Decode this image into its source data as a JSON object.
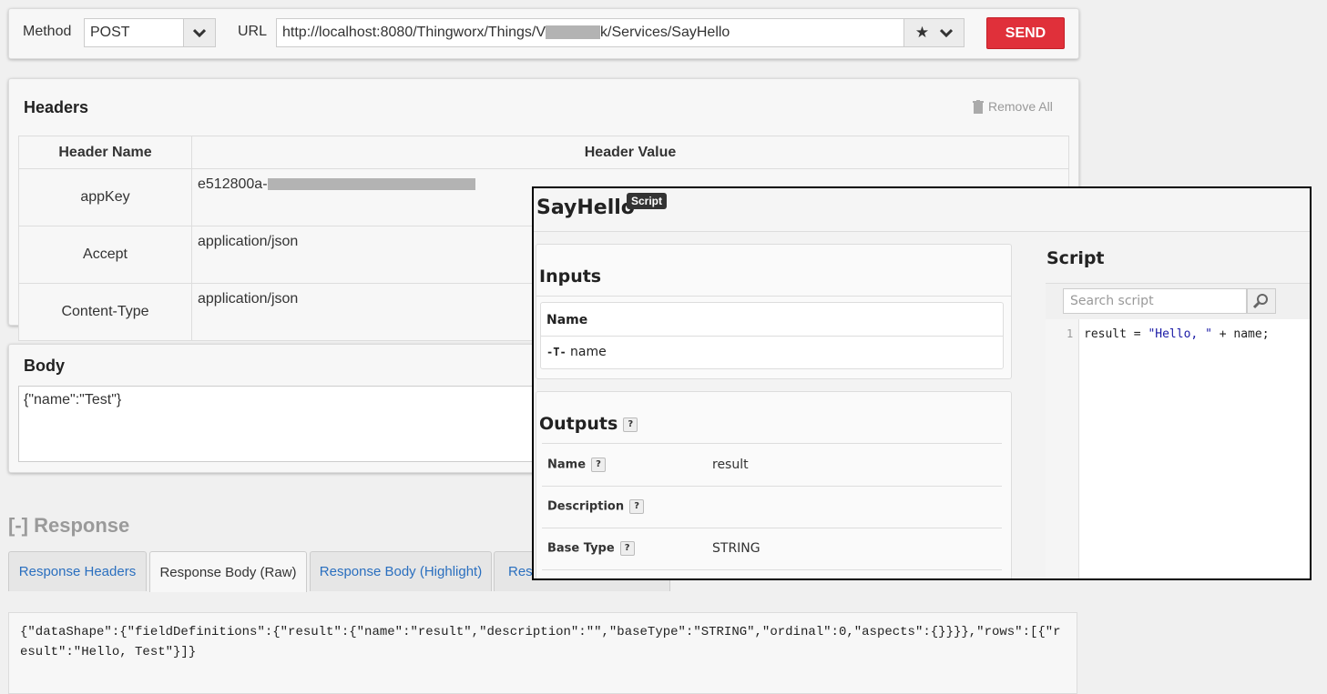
{
  "request": {
    "method_label": "Method",
    "method_value": "POST",
    "url_label": "URL",
    "url_prefix": "http://localhost:8080/Thingworx/Things/V",
    "url_suffix": "k/Services/SayHello",
    "send_label": "SEND"
  },
  "headers": {
    "title": "Headers",
    "remove_all": "Remove All",
    "col_name": "Header Name",
    "col_value": "Header Value",
    "rows": [
      {
        "name": "appKey",
        "value": "e512800a-"
      },
      {
        "name": "Accept",
        "value": "application/json"
      },
      {
        "name": "Content-Type",
        "value": "application/json"
      }
    ]
  },
  "body": {
    "title": "Body",
    "text": "{\"name\":\"Test\"}"
  },
  "response": {
    "title": "[-] Response",
    "tabs": [
      "Response Headers",
      "Response Body (Raw)",
      "Response Body (Highlight)",
      "Res"
    ],
    "active_tab": "Response Body (Raw)",
    "body_raw": "{\"dataShape\":{\"fieldDefinitions\":{\"result\":{\"name\":\"result\",\"description\":\"\",\"baseType\":\"STRING\",\"ordinal\":0,\"aspects\":{}}}},\"rows\":[{\"result\":\"Hello, Test\"}]}"
  },
  "overlay": {
    "title": "SayHello",
    "badge": "Script",
    "inputs_title": "Inputs",
    "inputs_col": "Name",
    "input_type_glyph": "-T-",
    "input_name": "name",
    "outputs_title": "Outputs",
    "help_glyph": "?",
    "outputs": [
      {
        "key": "Name",
        "value": "result"
      },
      {
        "key": "Description",
        "value": ""
      },
      {
        "key": "Base Type",
        "value": "STRING"
      }
    ],
    "script_title": "Script",
    "search_placeholder": "Search script",
    "line_number": "1",
    "code_a": "result = ",
    "code_str": "\"Hello, \"",
    "code_b": " + name;"
  },
  "colors": {
    "send": "#e0303a",
    "link": "#2a6fbf",
    "string_literal": "#1a1aa6"
  }
}
